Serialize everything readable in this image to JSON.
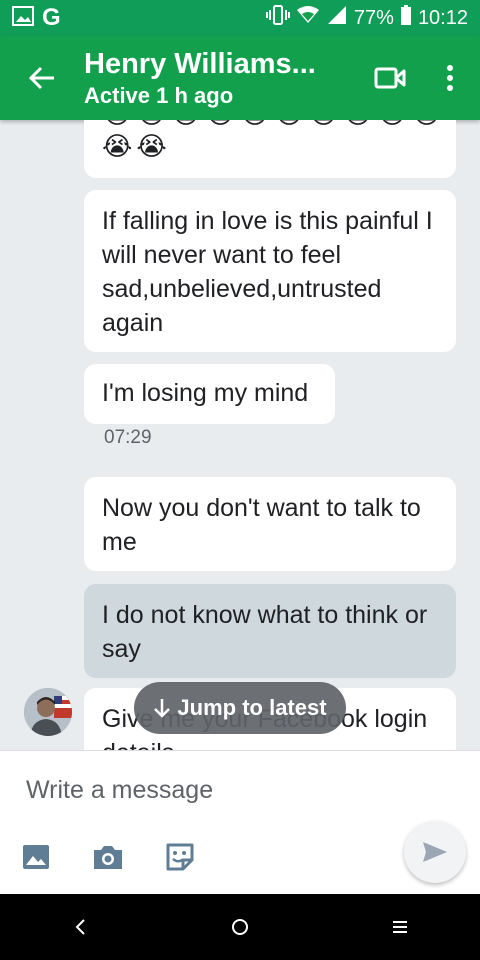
{
  "status_bar": {
    "g_logo": "G",
    "battery_percent": "77%",
    "time": "10:12"
  },
  "header": {
    "title": "Henry Williams...",
    "subtitle": "Active 1 h ago"
  },
  "messages": [
    {
      "type": "emoji_bubble",
      "emojis_row1": [
        "😭",
        "😭",
        "😭",
        "😭",
        "😭",
        "😭",
        "😭",
        "😭",
        "😭",
        "😭",
        "😭"
      ],
      "emojis_row2": [
        "😭",
        "😭"
      ]
    },
    {
      "type": "incoming",
      "text": "If falling in love is this painful I will never want to feel sad,unbelieved,untrusted again"
    },
    {
      "type": "incoming",
      "text": "I'm losing my mind"
    },
    {
      "type": "timestamp",
      "text": "07:29"
    },
    {
      "type": "incoming",
      "text": "Now you don't want to talk to me"
    },
    {
      "type": "outgoing",
      "text": "I do not know what to think or say"
    },
    {
      "type": "incoming",
      "text": "Give me your Facebook login details"
    }
  ],
  "jump_to_latest": {
    "label": "Jump to latest",
    "icon": "arrow-down-icon"
  },
  "composer": {
    "placeholder": "Write a message",
    "icons": [
      "image-icon",
      "camera-icon",
      "sticker-icon",
      "send-icon"
    ]
  },
  "nav_bar": {
    "icons": [
      "back-icon",
      "home-icon",
      "recents-icon"
    ]
  },
  "colors": {
    "status_bar": "#0f9d58",
    "app_bar": "#12a04d",
    "chat_bg": "#e9ecef",
    "outgoing_bubble": "#cfd8dc"
  }
}
